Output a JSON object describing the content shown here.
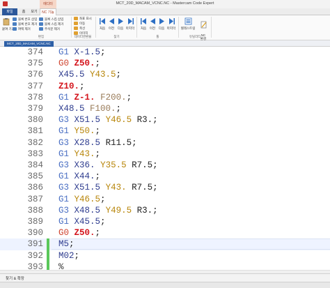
{
  "window": {
    "title": "MCT_20D_MACAM_VCNC.NC - Mastercam Code Expert",
    "context_tab_header": "에디터"
  },
  "tabs": [
    "파일",
    "홈",
    "보기",
    "NC 기능"
  ],
  "ribbon": {
    "paste_label": "붙여\n기기",
    "edit_group": {
      "items": [
        "블록 번호 삽입",
        "블록 번호 제거",
        "여백 제거",
        "블록 스킵 삽입",
        "블록 스킵 제거",
        "주석문 제거"
      ],
      "label": "편집"
    },
    "data_group": {
      "items": [
        "좌표 표시",
        "이동",
        "축선",
        "이미지"
      ],
      "label": "데이터변환율"
    },
    "nav1": {
      "buttons": [
        "처음",
        "이전",
        "다음",
        "마지막"
      ],
      "label": "찾기"
    },
    "nav2": {
      "buttons": [
        "처음",
        "이전",
        "다음",
        "마지막"
      ],
      "label": "툴"
    },
    "util_group": {
      "buttons": [
        "텔레스트링",
        "NC\n환경"
      ],
      "label": "유틸리티"
    }
  },
  "document_tab": "MCT_20D_MACAM_VCNC.NC",
  "code_lines": [
    {
      "n": "374",
      "tokens": [
        [
          "G1",
          "g1"
        ],
        [
          " ",
          "plain"
        ],
        [
          "X-1.5",
          "x"
        ],
        [
          ";",
          "plain"
        ]
      ]
    },
    {
      "n": "375",
      "tokens": [
        [
          "G0",
          "g0"
        ],
        [
          " ",
          "plain"
        ],
        [
          "Z50.",
          "z"
        ],
        [
          ";",
          "plain"
        ]
      ]
    },
    {
      "n": "376",
      "tokens": [
        [
          "X45.5",
          "x"
        ],
        [
          " ",
          "plain"
        ],
        [
          "Y43.5",
          "y"
        ],
        [
          ";",
          "plain"
        ]
      ]
    },
    {
      "n": "377",
      "tokens": [
        [
          "Z10.",
          "z"
        ],
        [
          ";",
          "plain"
        ]
      ]
    },
    {
      "n": "378",
      "tokens": [
        [
          "G1",
          "g1"
        ],
        [
          " ",
          "plain"
        ],
        [
          "Z-1.",
          "z"
        ],
        [
          " ",
          "plain"
        ],
        [
          "F200.",
          "f"
        ],
        [
          ";",
          "plain"
        ]
      ]
    },
    {
      "n": "379",
      "tokens": [
        [
          "X48.5",
          "x"
        ],
        [
          " ",
          "plain"
        ],
        [
          "F100.",
          "f"
        ],
        [
          ";",
          "plain"
        ]
      ]
    },
    {
      "n": "380",
      "tokens": [
        [
          "G3",
          "g3"
        ],
        [
          " ",
          "plain"
        ],
        [
          "X51.5",
          "x"
        ],
        [
          " ",
          "plain"
        ],
        [
          "Y46.5",
          "y"
        ],
        [
          " ",
          "plain"
        ],
        [
          "R3.",
          "r"
        ],
        [
          ";",
          "plain"
        ]
      ]
    },
    {
      "n": "381",
      "tokens": [
        [
          "G1",
          "g1"
        ],
        [
          " ",
          "plain"
        ],
        [
          "Y50.",
          "y"
        ],
        [
          ";",
          "plain"
        ]
      ]
    },
    {
      "n": "382",
      "tokens": [
        [
          "G3",
          "g3"
        ],
        [
          " ",
          "plain"
        ],
        [
          "X28.5",
          "x"
        ],
        [
          " ",
          "plain"
        ],
        [
          "R11.5",
          "r"
        ],
        [
          ";",
          "plain"
        ]
      ]
    },
    {
      "n": "383",
      "tokens": [
        [
          "G1",
          "g1"
        ],
        [
          " ",
          "plain"
        ],
        [
          "Y43.",
          "y"
        ],
        [
          ";",
          "plain"
        ]
      ]
    },
    {
      "n": "384",
      "tokens": [
        [
          "G3",
          "g3"
        ],
        [
          " ",
          "plain"
        ],
        [
          "X36.",
          "x"
        ],
        [
          " ",
          "plain"
        ],
        [
          "Y35.5",
          "y"
        ],
        [
          " ",
          "plain"
        ],
        [
          "R7.5",
          "r"
        ],
        [
          ";",
          "plain"
        ]
      ]
    },
    {
      "n": "385",
      "tokens": [
        [
          "G1",
          "g1"
        ],
        [
          " ",
          "plain"
        ],
        [
          "X44.",
          "x"
        ],
        [
          ";",
          "plain"
        ]
      ]
    },
    {
      "n": "386",
      "tokens": [
        [
          "G3",
          "g3"
        ],
        [
          " ",
          "plain"
        ],
        [
          "X51.5",
          "x"
        ],
        [
          " ",
          "plain"
        ],
        [
          "Y43.",
          "y"
        ],
        [
          " ",
          "plain"
        ],
        [
          "R7.5",
          "r"
        ],
        [
          ";",
          "plain"
        ]
      ]
    },
    {
      "n": "387",
      "tokens": [
        [
          "G1",
          "g1"
        ],
        [
          " ",
          "plain"
        ],
        [
          "Y46.5",
          "y"
        ],
        [
          ";",
          "plain"
        ]
      ]
    },
    {
      "n": "388",
      "tokens": [
        [
          "G3",
          "g3"
        ],
        [
          " ",
          "plain"
        ],
        [
          "X48.5",
          "x"
        ],
        [
          " ",
          "plain"
        ],
        [
          "Y49.5",
          "y"
        ],
        [
          " ",
          "plain"
        ],
        [
          "R3.",
          "r"
        ],
        [
          ";",
          "plain"
        ]
      ]
    },
    {
      "n": "389",
      "tokens": [
        [
          "G1",
          "g1"
        ],
        [
          " ",
          "plain"
        ],
        [
          "X45.5",
          "x"
        ],
        [
          ";",
          "plain"
        ]
      ]
    },
    {
      "n": "390",
      "tokens": [
        [
          "G0",
          "g0"
        ],
        [
          " ",
          "plain"
        ],
        [
          "Z50.",
          "z"
        ],
        [
          ";",
          "plain"
        ]
      ]
    },
    {
      "n": "391",
      "marked": true,
      "current": true,
      "tokens": [
        [
          "M5",
          "m"
        ],
        [
          ";",
          "plain"
        ]
      ]
    },
    {
      "n": "392",
      "marked": true,
      "tokens": [
        [
          "M02",
          "m"
        ],
        [
          ";",
          "plain"
        ]
      ]
    },
    {
      "n": "393",
      "marked": true,
      "tokens": [
        [
          "%",
          "pct"
        ]
      ]
    }
  ],
  "bottom_panel": {
    "label": "찾기 & 확장"
  },
  "colors": {
    "g_code": "#4a6fc3",
    "g0": "#d0442f",
    "z_word": "#d4141c",
    "y_word": "#b8860b",
    "x_word": "#2f3d8f",
    "f_word": "#9a7c5a",
    "change_marker": "#5ac85a"
  }
}
